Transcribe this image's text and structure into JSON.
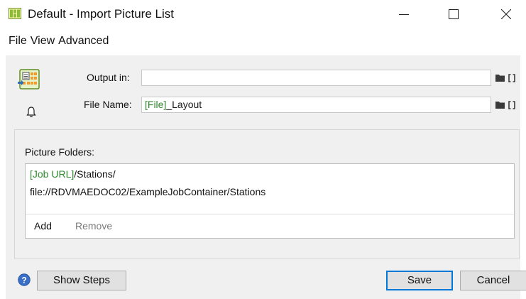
{
  "window": {
    "title": "Default - Import Picture List",
    "icon": "app-layout-icon",
    "controls": [
      "minimize",
      "maximize",
      "close"
    ]
  },
  "menu": [
    "File",
    "View",
    "Advanced"
  ],
  "output_in": {
    "label": "Output in:",
    "value": ""
  },
  "file_name": {
    "label": "File Name:",
    "value_token": "[File]",
    "value_rest": "_Layout"
  },
  "picture_folders": {
    "label": "Picture Folders:",
    "items": [
      {
        "token": "[Job URL]",
        "rest": "/Stations/"
      },
      {
        "token": "",
        "rest": "file://RDVMAEDOC02/ExampleJobContainer/Stations"
      }
    ],
    "add_label": "Add",
    "remove_label": "Remove"
  },
  "buttons": {
    "show_steps": "Show Steps",
    "save": "Save",
    "cancel": "Cancel"
  },
  "colors": {
    "token_green": "#2e8b2e",
    "save_border": "#0078d7",
    "help_blue": "#3a6fc7"
  }
}
